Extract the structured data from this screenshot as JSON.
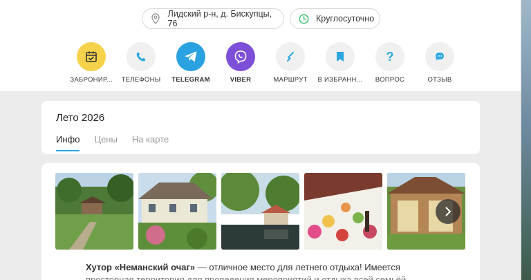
{
  "header": {
    "address": "Лидский р-н, д. Бискупцы, 76",
    "hours": "Круглосуточно"
  },
  "actions": [
    {
      "label": "ЗАБРОНИР...",
      "icon": "calendar-check-icon",
      "bg": "#f5d24a"
    },
    {
      "label": "ТЕЛЕФОНЫ",
      "icon": "phone-icon",
      "bg": "#f0f0f0"
    },
    {
      "label": "TELEGRAM",
      "icon": "telegram-icon",
      "bg": "#2aa1e0"
    },
    {
      "label": "VIBER",
      "icon": "viber-icon",
      "bg": "#7d4fd8"
    },
    {
      "label": "МАРШРУТ",
      "icon": "route-icon",
      "bg": "#f0f0f0"
    },
    {
      "label": "В ИЗБРАНН...",
      "icon": "bookmark-icon",
      "bg": "#f0f0f0"
    },
    {
      "label": "ВОПРОС",
      "icon": "question-icon",
      "bg": "#f0f0f0"
    },
    {
      "label": "ОТЗЫВ",
      "icon": "chat-bubble-icon",
      "bg": "#f0f0f0"
    }
  ],
  "section": {
    "title": "Лето 2026",
    "tabs": [
      "Инфо",
      "Цены",
      "На карте"
    ],
    "active_tab": "Инфо"
  },
  "gallery": {
    "photos": [
      "photo-1",
      "photo-2",
      "photo-3",
      "photo-4",
      "photo-5"
    ]
  },
  "description": {
    "name": "Хутор «Неманский очаг»",
    "text": " — отличное место для летнего отдыха! Имеется",
    "line2": "просторная территория для проведения мероприятий и отдыха всей семьёй"
  },
  "colors": {
    "accent": "#2aa7e0",
    "telegram": "#2aa1e0",
    "viber": "#7d4fd8",
    "book": "#f5d24a",
    "page_gray": "#ececec"
  }
}
